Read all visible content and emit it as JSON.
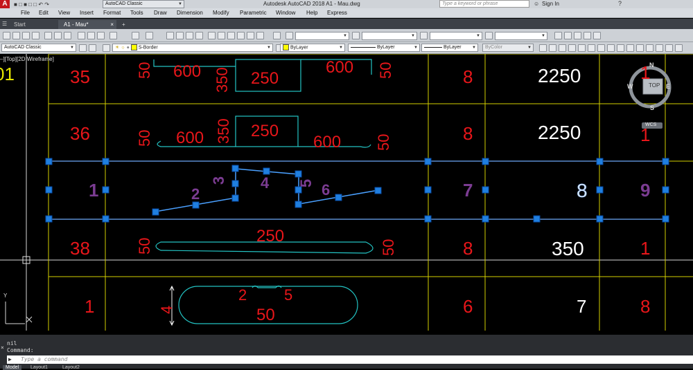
{
  "titlebar": {
    "app_logo": "A",
    "workspace": "AutoCAD Classic",
    "title": "Autodesk AutoCAD 2018    A1 - Mau.dwg",
    "search_placeholder": "Type a keyword or phrase",
    "sign_in": "Sign In"
  },
  "menu": [
    "File",
    "Edit",
    "View",
    "Insert",
    "Format",
    "Tools",
    "Draw",
    "Dimension",
    "Modify",
    "Parametric",
    "Window",
    "Help",
    "Express"
  ],
  "tabs": {
    "start": "Start",
    "doc": "A1 - Mau*",
    "add": "+"
  },
  "toolbar2": {
    "workspace": "AutoCAD Classic",
    "layer": "S-Border",
    "color": "ByLayer",
    "linetype": "ByLayer",
    "lineweight": "ByLayer",
    "plotstyle": "ByColor"
  },
  "viewport": {
    "label": "–][Top][2D Wireframe]"
  },
  "viewcube": {
    "top": "TOP",
    "n": "N",
    "s": "S",
    "w": "W",
    "e": "E",
    "wcs": "WCS"
  },
  "ucs": {
    "x": "X",
    "y": "Y"
  },
  "drawing": {
    "left_edge": "01",
    "rows": {
      "r35": {
        "num": "35",
        "d1": "50",
        "d2": "600",
        "d3": "350",
        "d4": "250",
        "d5": "600",
        "d6": "50",
        "qty": "8",
        "total": "2250",
        "last": "1"
      },
      "r36": {
        "num": "36",
        "d1": "50",
        "d2": "600",
        "d3": "350",
        "d4": "250",
        "d5": "600",
        "d6": "50",
        "qty": "8",
        "total": "2250",
        "last": "1"
      },
      "r37": {
        "c1": "1",
        "c2": "2",
        "c3": "3",
        "c4": "4",
        "c5": "5",
        "c6": "6",
        "c7": "7",
        "c8": "8",
        "c9": "9"
      },
      "r38": {
        "num": "38",
        "d1": "50",
        "d2": "250",
        "d3": "50",
        "qty": "8",
        "total": "350",
        "last": "1"
      },
      "r39": {
        "num": "1",
        "d1": "4",
        "d2": "2",
        "d3": "5",
        "d4": "50",
        "qty": "6",
        "total": "7",
        "last": "8"
      }
    }
  },
  "command": {
    "history1": "nil",
    "history2": "Command:",
    "placeholder": "Type a command"
  },
  "layout_tabs": {
    "model": "Model",
    "layout1": "Layout1",
    "layout2": "Layout2"
  }
}
